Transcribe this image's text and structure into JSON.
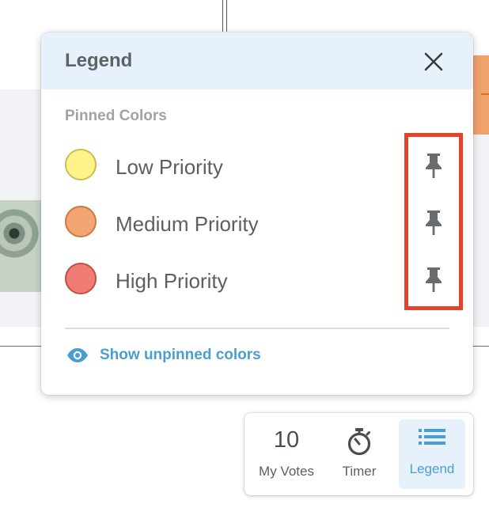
{
  "legend": {
    "title": "Legend",
    "section_label": "Pinned Colors",
    "items": [
      {
        "label": "Low Priority",
        "fill": "#fef38a",
        "border": "#c9bf4f"
      },
      {
        "label": "Medium Priority",
        "fill": "#f3a572",
        "border": "#c87a45"
      },
      {
        "label": "High Priority",
        "fill": "#f17c74",
        "border": "#c24e47"
      }
    ],
    "show_unpinned_label": "Show unpinned colors",
    "highlight_color": "#e4442b"
  },
  "toolbar": {
    "votes_count": "10",
    "votes_label": "My Votes",
    "timer_label": "Timer",
    "legend_label": "Legend"
  },
  "icons": [
    "close-icon",
    "pin-icon",
    "eye-icon",
    "timer-icon",
    "list-icon"
  ],
  "colors": {
    "header_bg": "#e6f1fb",
    "accent_blue": "#4a9fcf",
    "text_gray": "#5c5f62"
  }
}
